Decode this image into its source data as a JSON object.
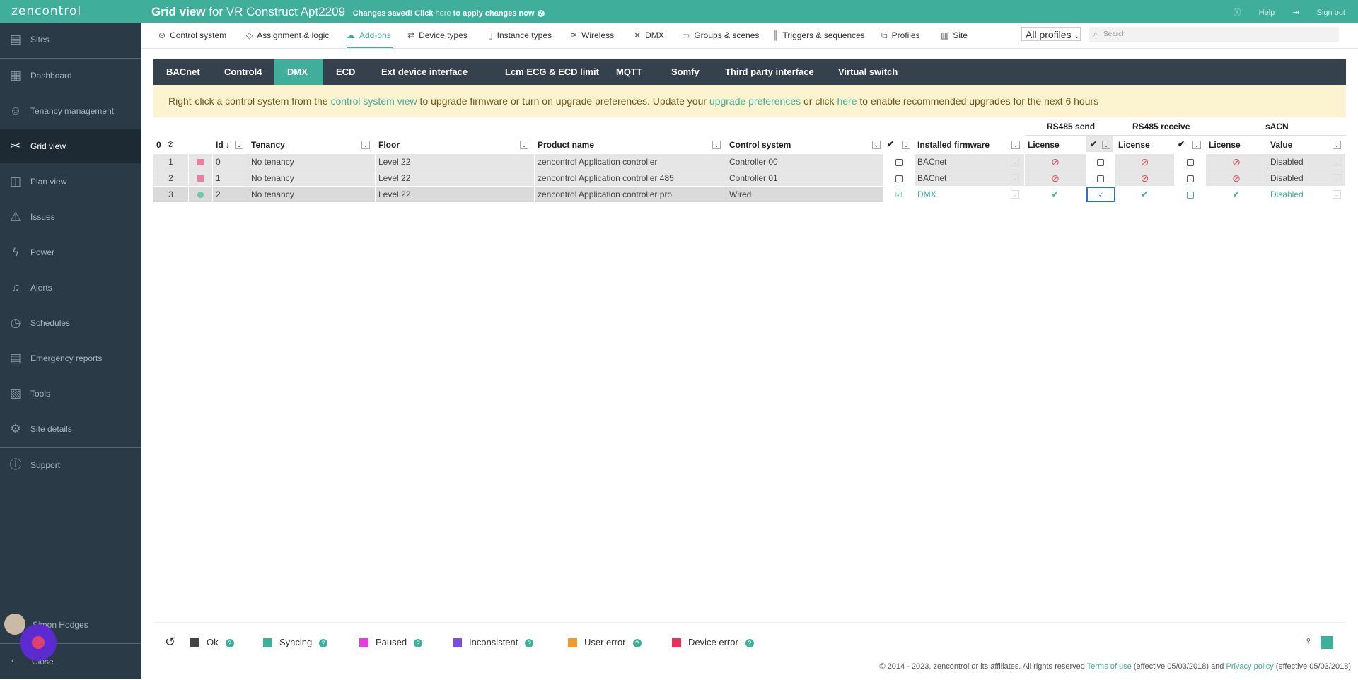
{
  "app": {
    "logo": "zencontrol",
    "title_strong": "Grid view",
    "title_rest": " for VR Construct Apt2209",
    "saved_pre": "Changes saved! Click ",
    "saved_link": "here",
    "saved_post": " to apply changes now",
    "help": "Help",
    "signout": "Sign out"
  },
  "sidebar": {
    "items": [
      {
        "label": "Sites",
        "icon": "sites-icon"
      },
      {
        "label": "Dashboard",
        "icon": "dashboard-icon"
      },
      {
        "label": "Tenancy management",
        "icon": "tenancy-icon"
      },
      {
        "label": "Grid view",
        "icon": "grid-view-icon"
      },
      {
        "label": "Plan view",
        "icon": "plan-view-icon"
      },
      {
        "label": "Issues",
        "icon": "warning-icon"
      },
      {
        "label": "Power",
        "icon": "power-icon"
      },
      {
        "label": "Alerts",
        "icon": "alerts-icon"
      },
      {
        "label": "Schedules",
        "icon": "schedules-icon"
      },
      {
        "label": "Emergency reports",
        "icon": "emergency-reports-icon"
      },
      {
        "label": "Tools",
        "icon": "tools-icon"
      },
      {
        "label": "Site details",
        "icon": "gear-icon"
      },
      {
        "label": "Support",
        "icon": "info-icon"
      }
    ],
    "user": "Simon Hodges",
    "close": "Close"
  },
  "tabs": [
    "Control system",
    "Assignment & logic",
    "Add-ons",
    "Device types",
    "Instance types",
    "Wireless",
    "DMX",
    "Groups & scenes",
    "Triggers & sequences",
    "Profiles",
    "Site"
  ],
  "profiles_value": "All profiles",
  "search_placeholder": "Search",
  "subtabs": [
    "BACnet",
    "Control4",
    "DMX",
    "ECD",
    "Ext device interface",
    "Lcm ECG & ECD limit",
    "MQTT",
    "Somfy",
    "Third party interface",
    "Virtual switch"
  ],
  "banner": {
    "t1": "Right-click a control system from the ",
    "l1": "control system view",
    "t2": " to upgrade firmware or turn on upgrade preferences. Update your ",
    "l2": "upgrade preferences",
    "t3": " or click ",
    "l3": "here",
    "t4": " to enable recommended upgrades for the next 6 hours"
  },
  "grid": {
    "group_headers": {
      "rs485_send": "RS485 send",
      "rs485_receive": "RS485 receive",
      "sacn": "sACN"
    },
    "count": "0",
    "headers": {
      "id": "Id ↓",
      "tenancy": "Tenancy",
      "floor": "Floor",
      "product": "Product name",
      "control": "Control system",
      "firmware": "Installed firmware",
      "license": "License",
      "value": "Value"
    },
    "rows": [
      {
        "num": "1",
        "id": "0",
        "tenancy": "No tenancy",
        "floor": "Level 22",
        "product": "zencontrol Application controller",
        "control": "Controller 00",
        "firmware": "BACnet",
        "value": "Disabled"
      },
      {
        "num": "2",
        "id": "1",
        "tenancy": "No tenancy",
        "floor": "Level 22",
        "product": "zencontrol Application controller 485",
        "control": "Controller 01",
        "firmware": "BACnet",
        "value": "Disabled"
      },
      {
        "num": "3",
        "id": "2",
        "tenancy": "No tenancy",
        "floor": "Level 22",
        "product": "zencontrol Application controller pro",
        "control": "Wired",
        "firmware": "DMX",
        "value": "Disabled"
      }
    ]
  },
  "legend": [
    {
      "label": "Ok",
      "color": "#444444"
    },
    {
      "label": "Syncing",
      "color": "#3fae9b"
    },
    {
      "label": "Paused",
      "color": "#e040d8"
    },
    {
      "label": "Inconsistent",
      "color": "#7a4fe0"
    },
    {
      "label": "User error",
      "color": "#f39a2a"
    },
    {
      "label": "Device error",
      "color": "#e8325a"
    }
  ],
  "footer": {
    "t1": "© 2014 - 2023, zencontrol or its affiliates. All rights reserved ",
    "l1": "Terms of use",
    "t2": " (effective 05/03/2018) and ",
    "l2": "Privacy policy",
    "t3": " (effective 05/03/2018)"
  }
}
